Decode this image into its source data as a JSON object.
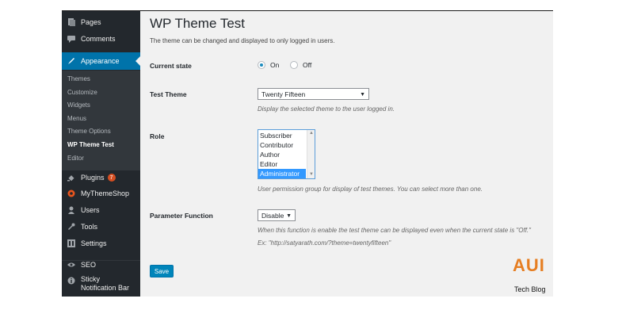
{
  "sidebar": {
    "items": [
      {
        "label": "Pages",
        "icon": "pages-icon"
      },
      {
        "label": "Comments",
        "icon": "comments-icon"
      },
      {
        "label": "Appearance",
        "icon": "appearance-icon"
      },
      {
        "label": "Plugins",
        "icon": "plugins-icon",
        "badge": "7"
      },
      {
        "label": "MyThemeShop",
        "icon": "mythemeshop-icon"
      },
      {
        "label": "Users",
        "icon": "users-icon"
      },
      {
        "label": "Tools",
        "icon": "tools-icon"
      },
      {
        "label": "Settings",
        "icon": "settings-icon"
      },
      {
        "label": "SEO",
        "icon": "seo-icon"
      },
      {
        "label": "Sticky Notification Bar",
        "icon": "info-icon"
      }
    ],
    "submenu": [
      "Themes",
      "Customize",
      "Widgets",
      "Menus",
      "Theme Options",
      "WP Theme Test",
      "Editor"
    ],
    "active_color": "#0073aa",
    "badge_color": "#d54e21"
  },
  "main": {
    "title": "WP Theme Test",
    "description": "The theme can be changed and displayed to only logged in users.",
    "current_state": {
      "label": "Current state",
      "on_label": "On",
      "off_label": "Off",
      "selected": "On"
    },
    "test_theme": {
      "label": "Test Theme",
      "value": "Twenty Fifteen",
      "help": "Display the selected theme to the user logged in."
    },
    "role": {
      "label": "Role",
      "options": [
        "Subscriber",
        "Contributor",
        "Author",
        "Editor",
        "Administrator"
      ],
      "selected": "Administrator",
      "help": "User permission group for display of test themes. You can select more than one."
    },
    "parameter_function": {
      "label": "Parameter Function",
      "value": "Disable",
      "help_line1": "When this function is enable the test theme can be displayed even when the current state is \"Off.\"",
      "help_line2": "Ex: \"http://satyarath.com/?theme=twentyfifteen\""
    },
    "save_label": "Save",
    "logo": {
      "brand": "AUI",
      "tagline": "Tech Blog"
    }
  }
}
